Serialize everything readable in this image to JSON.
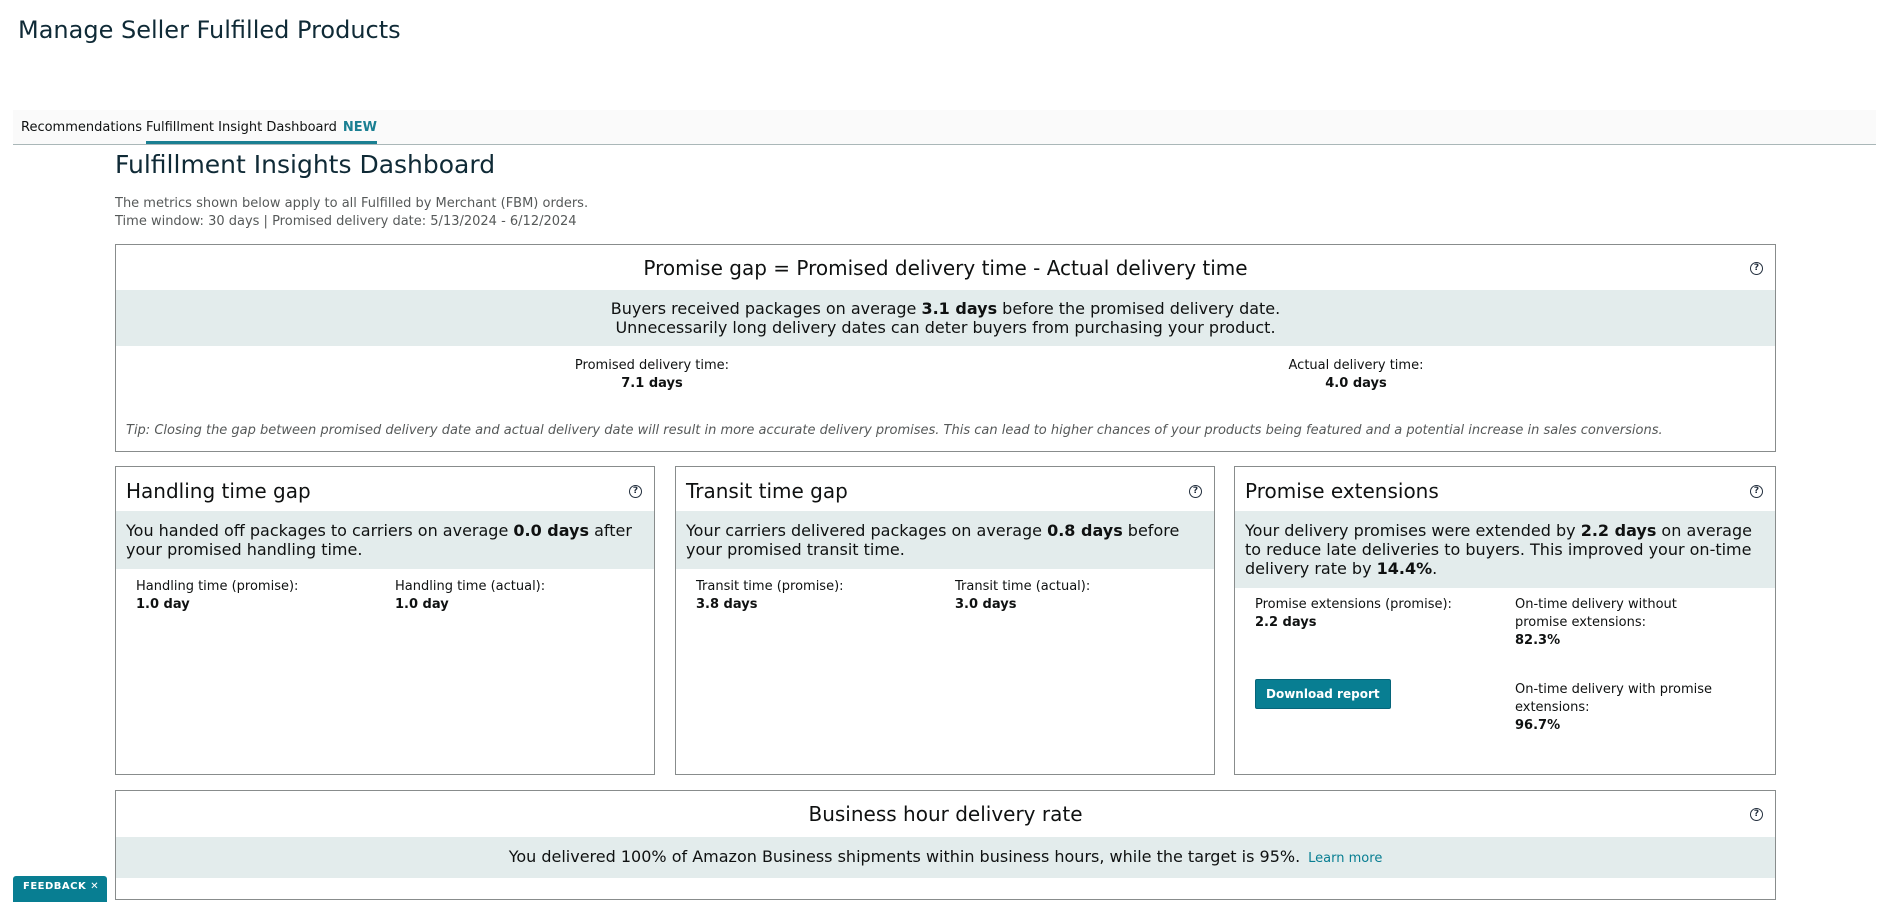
{
  "page_title": "Manage Seller Fulfilled Products",
  "tabs": [
    {
      "label": "Recommendations"
    },
    {
      "label": "Fulfillment Insight Dashboard",
      "badge": "NEW"
    }
  ],
  "dashboard": {
    "title": "Fulfillment Insights Dashboard",
    "meta_line1": "The metrics shown below apply to all Fulfilled by Merchant (FBM) orders.",
    "meta_line2": "Time window: 30 days | Promised delivery date: 5/13/2024 - 6/12/2024"
  },
  "promise_gap": {
    "title": "Promise gap = Promised delivery time - Actual delivery time",
    "band_pre": "Buyers received packages on average ",
    "band_bold": "3.1 days",
    "band_post": " before the promised delivery date.",
    "band_line2": "Unnecessarily long delivery dates can deter buyers from purchasing your product.",
    "promised_label": "Promised delivery time:",
    "promised_value": "7.1 days",
    "actual_label": "Actual delivery time:",
    "actual_value": "4.0 days",
    "tip": "Tip: Closing the gap between promised delivery date and actual delivery date will result in more accurate delivery promises. This can lead to higher chances of your products being featured and a potential increase in sales conversions."
  },
  "handling": {
    "title": "Handling time gap",
    "band_pre": "You handed off packages to carriers on average ",
    "band_bold": "0.0 days",
    "band_post": " after your promised handling time.",
    "promise_label": "Handling time (promise):",
    "promise_value": "1.0 day",
    "actual_label": "Handling time (actual):",
    "actual_value": "1.0 day"
  },
  "transit": {
    "title": "Transit time gap",
    "band_pre": "Your carriers delivered packages on average ",
    "band_bold": "0.8 days",
    "band_post": " before your promised transit time.",
    "promise_label": "Transit time (promise):",
    "promise_value": "3.8 days",
    "actual_label": "Transit time (actual):",
    "actual_value": "3.0 days"
  },
  "extensions": {
    "title": "Promise extensions",
    "band_pre": "Your delivery promises were extended by ",
    "band_bold": "2.2 days",
    "band_mid": " on average to reduce late deliveries to buyers. This improved your on-time delivery rate by ",
    "band_bold2": "14.4%",
    "band_post": ".",
    "ext_label": "Promise extensions (promise):",
    "ext_value": "2.2 days",
    "without_label": "On-time delivery without promise extensions:",
    "without_value": "82.3%",
    "with_label": "On-time delivery with promise extensions:",
    "with_value": "96.7%",
    "download_label": "Download report"
  },
  "business": {
    "title": "Business hour delivery rate",
    "band_text": "You delivered 100% of Amazon Business shipments within business hours, while the target is 95%.",
    "learn_more": "Learn more"
  },
  "feedback_label": "FEEDBACK ✕",
  "help_glyph": "?",
  "colors": {
    "accent": "#087e92",
    "band": "#e3ecec",
    "tab_underline": "#1a7f92"
  }
}
